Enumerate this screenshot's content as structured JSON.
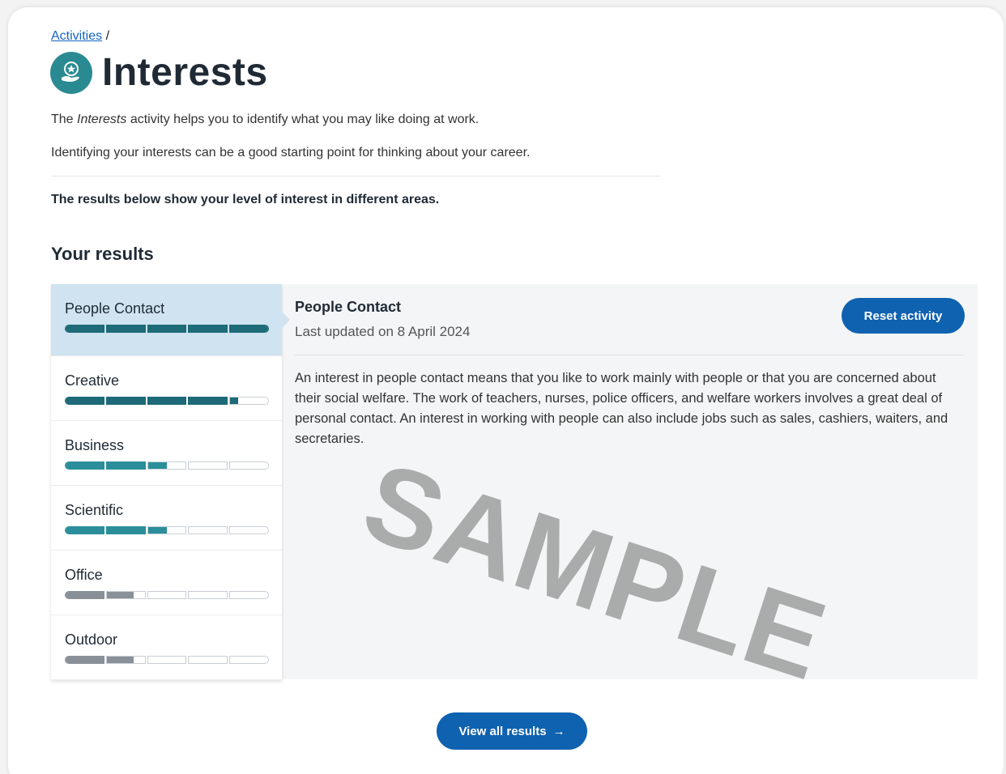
{
  "breadcrumb": {
    "link": "Activities",
    "separator": "/"
  },
  "header": {
    "title": "Interests",
    "icon": "hand-star-icon"
  },
  "intro": {
    "prefix": "The ",
    "emphasis": "Interests",
    "suffix": " activity helps you to identify what you may like doing at work.",
    "line2": "Identifying your interests can be a good starting point for thinking about your career."
  },
  "lead": "The results below show your level of interest in different areas.",
  "section_title": "Your results",
  "colors": {
    "dark_teal": "#1d6a78",
    "teal": "#2a8f9a",
    "grey": "#8a9097",
    "primary": "#0e62b0",
    "active_bg": "#cfe3f0"
  },
  "sidebar": {
    "items": [
      {
        "label": "People Contact",
        "level": 5.0,
        "color": "#1d6a78",
        "active": true
      },
      {
        "label": "Creative",
        "level": 4.2,
        "color": "#1d6a78"
      },
      {
        "label": "Business",
        "level": 2.5,
        "color": "#2a8f9a"
      },
      {
        "label": "Scientific",
        "level": 2.5,
        "color": "#2a8f9a"
      },
      {
        "label": "Office",
        "level": 1.7,
        "color": "#8a9097"
      },
      {
        "label": "Outdoor",
        "level": 1.7,
        "color": "#8a9097"
      }
    ],
    "segments": 5
  },
  "detail": {
    "title": "People Contact",
    "updated": "Last updated on 8 April 2024",
    "reset_label": "Reset activity",
    "body": "An interest in people contact means that you like to work mainly with people or that you are concerned about their social welfare. The work of teachers, nurses, police officers, and welfare workers involves a great deal of personal contact. An interest in working with people can also include jobs such as sales, cashiers, waiters, and secretaries."
  },
  "watermark": "SAMPLE",
  "footer": {
    "view_all_label": "View all results",
    "arrow": "→"
  }
}
